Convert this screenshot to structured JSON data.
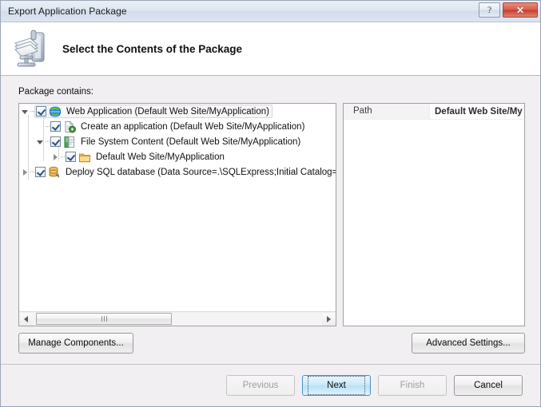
{
  "window": {
    "title": "Export Application Package",
    "help_button": "?",
    "close_button": "✕"
  },
  "header": {
    "title": "Select the Contents of the Package",
    "icon": "package-compress-icon"
  },
  "main": {
    "section_label": "Package contains:",
    "tree": [
      {
        "label": "Web Application (Default Web Site/MyApplication)",
        "indent": 0,
        "expander": "expanded",
        "checked": true,
        "icon": "globe-icon",
        "selected": true
      },
      {
        "label": "Create an application (Default Web Site/MyApplication)",
        "indent": 1,
        "expander": "none",
        "checked": true,
        "icon": "application-page-icon",
        "selected": false
      },
      {
        "label": "File System Content (Default Web Site/MyApplication)",
        "indent": 1,
        "expander": "expanded",
        "checked": true,
        "icon": "file-system-icon",
        "selected": false
      },
      {
        "label": "Default Web Site/MyApplication",
        "indent": 2,
        "expander": "collapsed",
        "checked": true,
        "icon": "folder-icon",
        "selected": false
      },
      {
        "label": "Deploy SQL database (Data Source=.\\SQLExpress;Initial Catalog=",
        "indent": 0,
        "expander": "collapsed",
        "checked": true,
        "icon": "database-icon",
        "selected": false
      }
    ],
    "properties": [
      {
        "key": "Path",
        "value": "Default Web Site/My"
      }
    ],
    "scrollbar": {
      "left_arrow": "◀",
      "right_arrow": "▶"
    }
  },
  "actions": {
    "manage_components": "Manage Components...",
    "advanced_settings": "Advanced Settings...",
    "previous": "Previous",
    "next": "Next",
    "finish": "Finish",
    "cancel": "Cancel"
  },
  "colors": {
    "accent": "#b9e0f6",
    "close": "#c33f2c",
    "dialog_bg": "#f1eff1"
  }
}
